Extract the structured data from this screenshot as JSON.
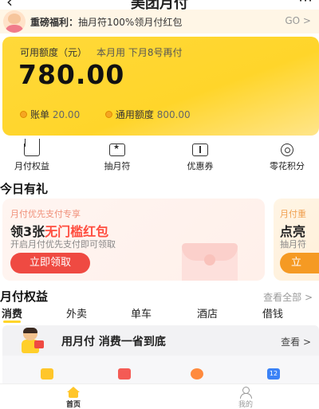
{
  "header": {
    "back_icon": "‹",
    "title": "美团月付",
    "more_icon": "⋯"
  },
  "notice": {
    "prefix": "重磅福利：",
    "text": "抽月符100%领月付红包",
    "go": "GO >"
  },
  "credit": {
    "label": "可用额度（元）",
    "repay_note": "本月用 下月8号再付",
    "amount": "780.00",
    "bill_label": "账单",
    "bill_value": "20.00",
    "total_label": "通用额度",
    "total_value": "800.00"
  },
  "shortcuts": [
    {
      "label": "月付权益",
      "icon": "crown-icon"
    },
    {
      "label": "抽月符",
      "icon": "gift-box-icon"
    },
    {
      "label": "优惠券",
      "icon": "ticket-icon"
    },
    {
      "label": "零花积分",
      "icon": "coin-icon"
    }
  ],
  "today": {
    "title": "今日有礼",
    "promo1": {
      "tag": "月付优先支付专享",
      "headline_prefix": "领3张",
      "headline_highlight": "无门槛红包",
      "desc": "开启月付优先支付即可领取",
      "button": "立即领取"
    },
    "promo2": {
      "tag": "月付重",
      "headline": "点亮",
      "desc": "抽月符",
      "button": "立"
    }
  },
  "benefits": {
    "title": "月付权益",
    "see_all": "查看全部 >",
    "tabs": [
      "消费",
      "外卖",
      "单车",
      "酒店",
      "借钱"
    ],
    "active_tab": "消费",
    "banner_text": "用月付 消费一省到底",
    "banner_link": "查看 >",
    "calendar_day": "12"
  },
  "bottom_nav": {
    "home": "首页",
    "mine": "我的"
  },
  "colors": {
    "brand_yellow": "#ffd52a",
    "accent_red": "#ef4a42",
    "accent_orange": "#f59a23"
  }
}
